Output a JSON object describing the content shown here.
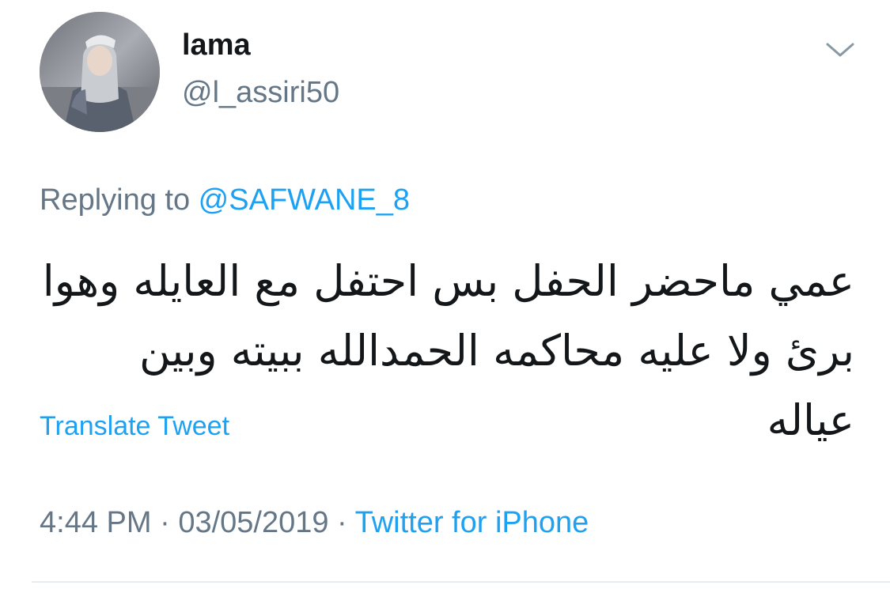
{
  "tweet": {
    "author": {
      "display_name": "lama",
      "handle": "@l_assiri50"
    },
    "reply": {
      "prefix": "Replying to ",
      "mention": "@SAFWANE_8"
    },
    "text": "عمي ماحضر الحفل بس احتفل مع العايله وهوا برئ ولا عليه محاكمه الحمدالله ببيته وبين عياله",
    "translate_label": "Translate Tweet",
    "time": "4:44 PM",
    "separator_1": " · ",
    "date": "03/05/2019",
    "separator_2": " · ",
    "source": "Twitter for iPhone"
  },
  "icons": {
    "menu": "chevron-down-icon"
  },
  "colors": {
    "accent": "#1da1f2",
    "text": "#14171a",
    "secondary": "#657786",
    "divider": "#e6ecf0"
  }
}
